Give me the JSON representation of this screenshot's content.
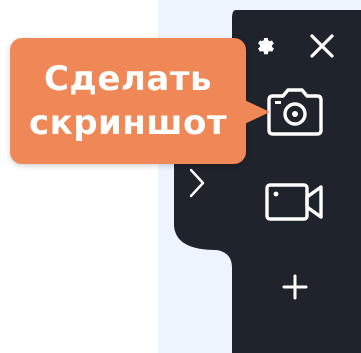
{
  "tooltip": {
    "line1": "Сделать",
    "line2": "скриншот"
  },
  "icons": {
    "settings": "gear-icon",
    "close": "close-icon",
    "screenshot": "camera-icon",
    "record": "video-camera-icon",
    "expand": "chevron-right-icon",
    "add": "plus-icon"
  },
  "colors": {
    "panel": "#1f232b",
    "panel_icon": "#ffffff",
    "tooltip": "#f08757",
    "screen_background": "#eef4fd"
  }
}
